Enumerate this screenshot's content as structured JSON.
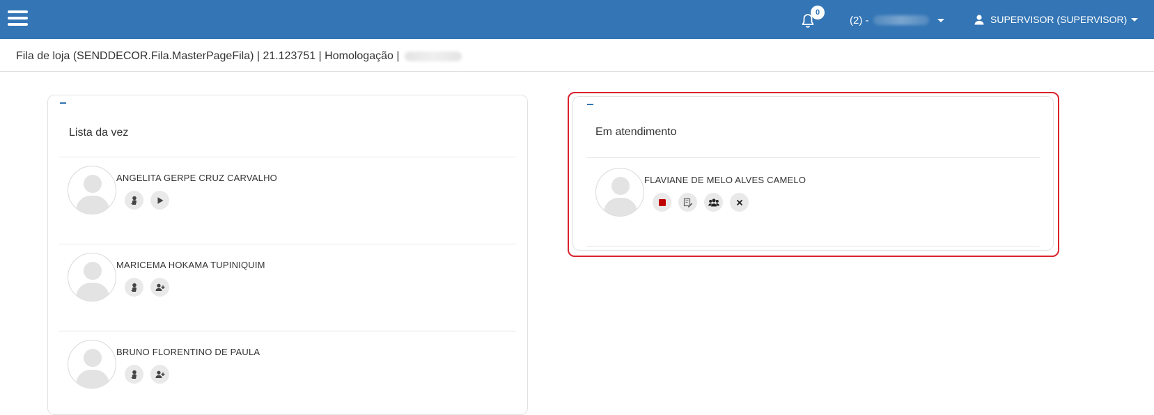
{
  "header": {
    "notifications_count": "0",
    "store_selector": "(2) -",
    "user_label": "SUPERVISOR (SUPERVISOR)"
  },
  "breadcrumb": {
    "text": "Fila de loja (SENDDECOR.Fila.MasterPageFila) | 21.123751 | Homologação |"
  },
  "queue_panel": {
    "title": "Lista da vez",
    "people": [
      {
        "name": "ANGELITA GERPE CRUZ CARVALHO",
        "actions": [
          "person-icon",
          "play-icon"
        ]
      },
      {
        "name": "MARICEMA HOKAMA TUPINIQUIM",
        "actions": [
          "person-icon",
          "add-person-icon"
        ]
      },
      {
        "name": "BRUNO FLORENTINO DE PAULA",
        "actions": [
          "person-icon",
          "add-person-icon"
        ]
      }
    ]
  },
  "attending_panel": {
    "title": "Em atendimento",
    "people": [
      {
        "name": "FLAVIANE DE MELO ALVES CAMELO",
        "actions": [
          "stop-icon",
          "edit-icon",
          "group-icon",
          "close-icon"
        ]
      }
    ]
  },
  "colors": {
    "topbar": "#3375b5",
    "highlight": "#d9232d",
    "stop": "#c00000"
  }
}
